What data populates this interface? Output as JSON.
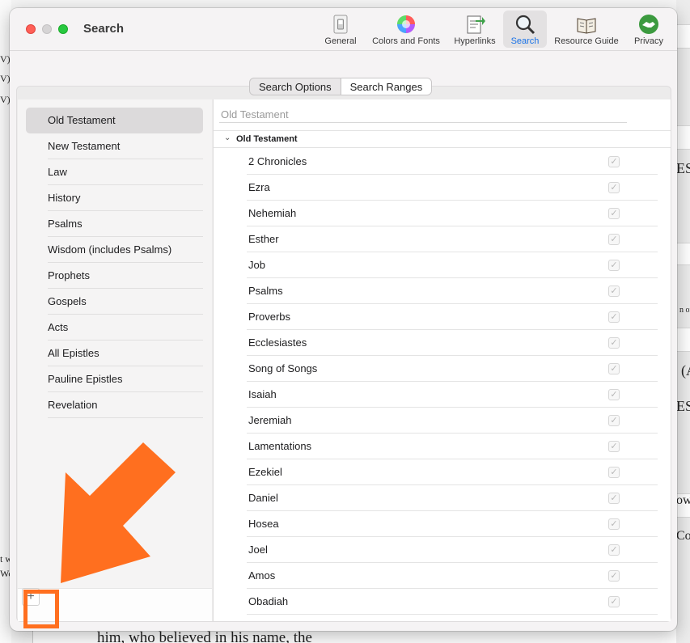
{
  "window": {
    "title": "Search"
  },
  "toolbar": {
    "items": [
      {
        "label": "General",
        "icon": "switch-icon"
      },
      {
        "label": "Colors and Fonts",
        "icon": "color-wheel-icon"
      },
      {
        "label": "Hyperlinks",
        "icon": "document-link-icon"
      },
      {
        "label": "Search",
        "icon": "magnifier-icon",
        "active": true
      },
      {
        "label": "Resource Guide",
        "icon": "book-icon"
      },
      {
        "label": "Privacy",
        "icon": "handshake-icon"
      }
    ]
  },
  "tabs": {
    "search_options": "Search Options",
    "search_ranges": "Search Ranges"
  },
  "sidebar": {
    "items": [
      "Old Testament",
      "New Testament",
      "Law",
      "History",
      "Psalms",
      "Wisdom (includes Psalms)",
      "Prophets",
      "Gospels",
      "Acts",
      "All Epistles",
      "Pauline Epistles",
      "Revelation"
    ],
    "selected": "Old Testament",
    "add_button": "+"
  },
  "range": {
    "name_placeholder": "Old Testament",
    "group_label": "Old Testament",
    "books": [
      "2 Chronicles",
      "Ezra",
      "Nehemiah",
      "Esther",
      "Job",
      "Psalms",
      "Proverbs",
      "Ecclesiastes",
      "Song of Songs",
      "Isaiah",
      "Jeremiah",
      "Lamentations",
      "Ezekiel",
      "Daniel",
      "Hosea",
      "Joel",
      "Amos",
      "Obadiah"
    ],
    "check_mark": "✓"
  },
  "background": {
    "left_frags": [
      "V)",
      "V)",
      "V)"
    ],
    "right_frags": [
      "ESV",
      "(A",
      "ESV",
      "own",
      "Con",
      "n or"
    ],
    "bottom_left_frags": [
      "t w",
      "Wo"
    ],
    "bottom_text": "him, who believed in his name, the"
  },
  "colors": {
    "annotation": "#ff6f1f",
    "accent": "#1a73e8"
  }
}
